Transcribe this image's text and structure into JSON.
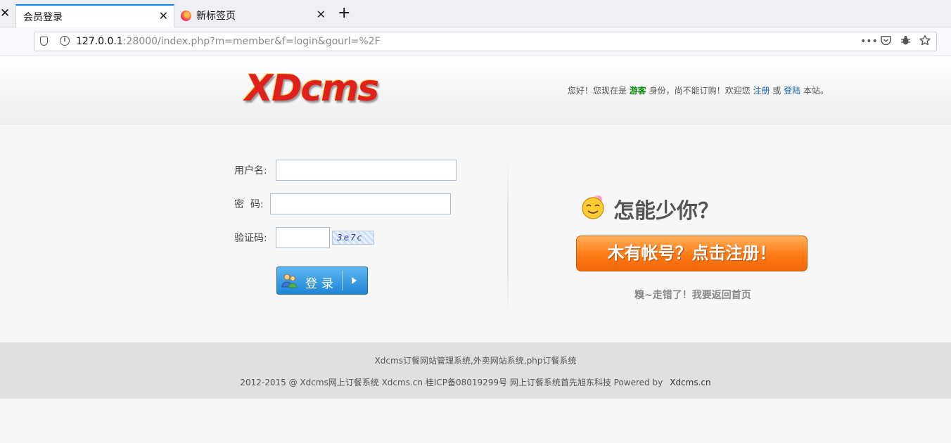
{
  "browser": {
    "tabs": [
      {
        "title": "会员登录",
        "active": true
      },
      {
        "title": "新标签页",
        "active": false
      }
    ],
    "url_host": "127.0.0.1",
    "url_rest": ":28000/index.php?m=member&f=login&gourl=%2F"
  },
  "header": {
    "logo_text": "XDcms",
    "greeting_prefix": "您好！您现在是",
    "guest_label": "游客",
    "greeting_middle": "身份，尚不能订购！欢迎您",
    "register_link": "注册",
    "or_text": "或",
    "login_link": "登陆",
    "greeting_suffix": "本站。"
  },
  "login_form": {
    "username_label": "用户名:",
    "password_label": "密  码:",
    "captcha_label": "验证码:",
    "username_value": "",
    "password_value": "",
    "captcha_value": "",
    "captcha_image_text": "3e7c",
    "submit_label": "登录"
  },
  "promo": {
    "title": "怎能少你？",
    "register_button": "木有帐号？点击注册！",
    "back_home_link": "糗~走错了！我要返回首页"
  },
  "footer": {
    "line1": "Xdcms订餐网站管理系统,外卖网站系统,php订餐系统",
    "line2": "2012-2015 @ Xdcms网上订餐系统 Xdcms.cn 桂ICP备08019299号 网上订餐系统首先旭东科技 Powered by",
    "powered_link": "Xdcms.cn"
  },
  "colors": {
    "accent_blue": "#0a84ff",
    "guest_green": "#0a8a0a",
    "link_blue": "#1a5fb4",
    "register_orange": "#ff7a14",
    "logo_red": "#e0201a"
  },
  "icons": [
    "close-icon",
    "firefox-icon",
    "plus-icon",
    "shield-icon",
    "info-icon",
    "more-icon",
    "pocket-icon",
    "extension-icon",
    "star-icon",
    "users-icon",
    "arrow-right-icon",
    "smiley-icon"
  ]
}
